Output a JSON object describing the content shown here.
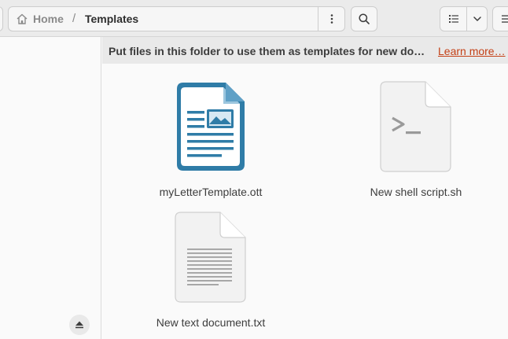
{
  "path": {
    "home_label": "Home",
    "separator": "/",
    "current": "Templates"
  },
  "infobar": {
    "message": "Put files in this folder to use them as templates for new documents.",
    "link": "Learn more…"
  },
  "files": [
    {
      "name": "myLetterTemplate.ott",
      "icon": "office-template-icon"
    },
    {
      "name": "New shell script.sh",
      "icon": "shell-script-icon"
    },
    {
      "name": "New text document.txt",
      "icon": "text-document-icon"
    }
  ],
  "icon_names": {
    "home": "home-icon",
    "path_menu": "vertical-dots-icon",
    "search": "search-icon",
    "view_list": "list-view-icon",
    "view_dropdown": "chevron-down-icon",
    "menu": "hamburger-icon",
    "eject": "eject-icon"
  },
  "colors": {
    "headerbar": "#ebebeb",
    "infobar": "#e9e9e9",
    "link": "#c44016",
    "template_icon": "#2f7ca7"
  }
}
